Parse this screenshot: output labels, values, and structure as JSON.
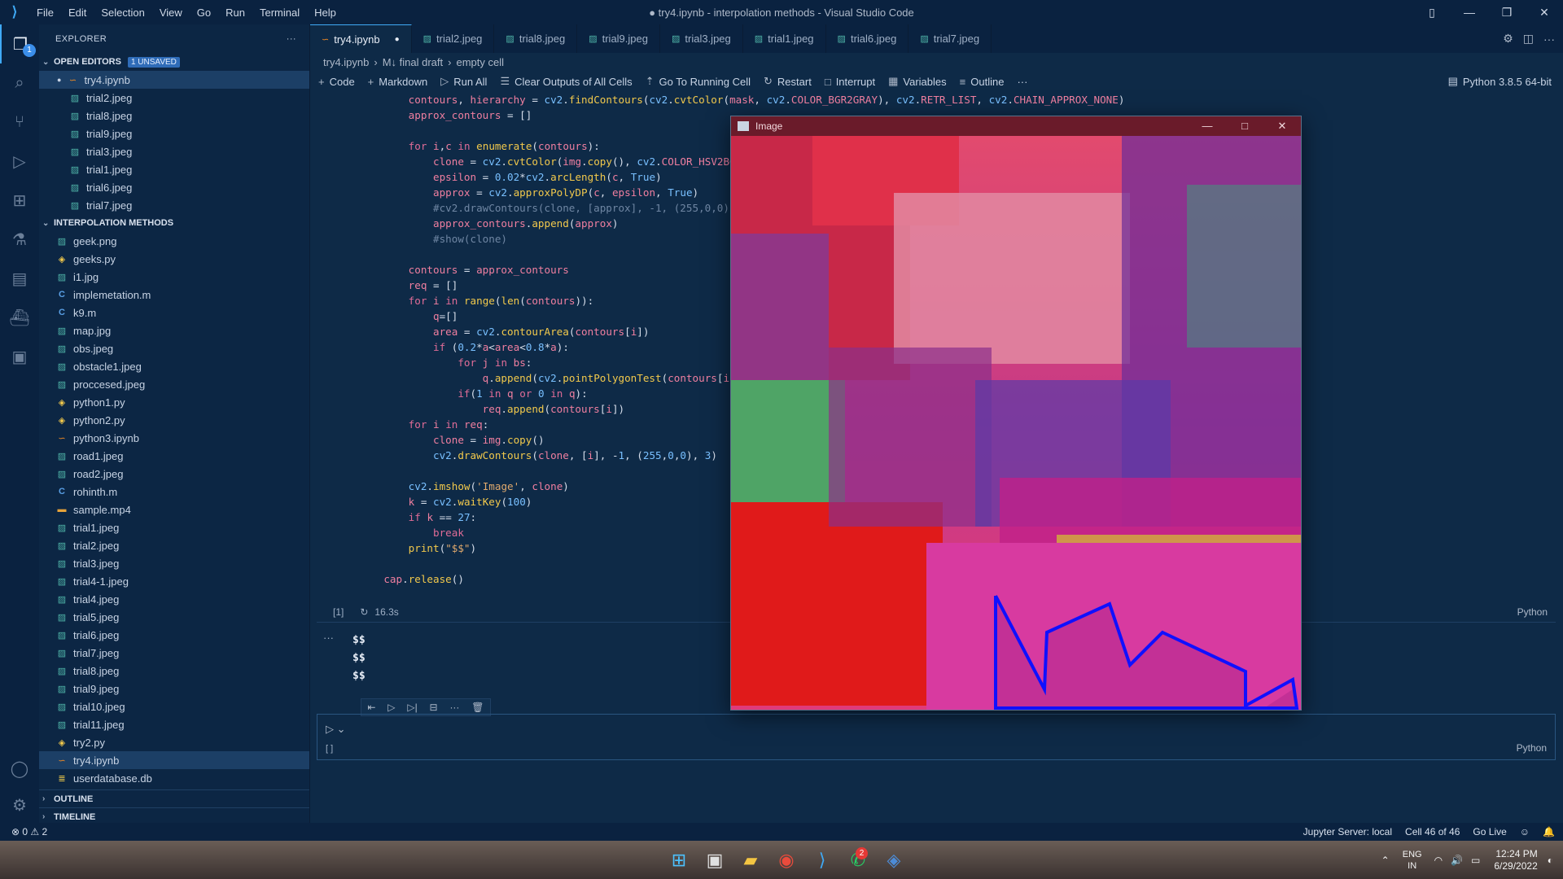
{
  "app": {
    "window_title": "● try4.ipynb - interpolation methods - Visual Studio Code",
    "menu": [
      "File",
      "Edit",
      "Selection",
      "View",
      "Go",
      "Run",
      "Terminal",
      "Help"
    ]
  },
  "explorer": {
    "title": "EXPLORER",
    "open_editors_label": "OPEN EDITORS",
    "unsaved_badge": "1 UNSAVED",
    "open_editors": [
      "try4.ipynb",
      "trial2.jpeg",
      "trial8.jpeg",
      "trial9.jpeg",
      "trial3.jpeg",
      "trial1.jpeg",
      "trial6.jpeg",
      "trial7.jpeg"
    ],
    "folder_label": "INTERPOLATION METHODS",
    "files": [
      {
        "name": "geek.png",
        "type": "img"
      },
      {
        "name": "geeks.py",
        "type": "py"
      },
      {
        "name": "i1.jpg",
        "type": "img"
      },
      {
        "name": "implemetation.m",
        "type": "m"
      },
      {
        "name": "k9.m",
        "type": "m"
      },
      {
        "name": "map.jpg",
        "type": "img"
      },
      {
        "name": "obs.jpeg",
        "type": "img"
      },
      {
        "name": "obstacle1.jpeg",
        "type": "img"
      },
      {
        "name": "proccesed.jpeg",
        "type": "img"
      },
      {
        "name": "python1.py",
        "type": "py"
      },
      {
        "name": "python2.py",
        "type": "py"
      },
      {
        "name": "python3.ipynb",
        "type": "nb"
      },
      {
        "name": "road1.jpeg",
        "type": "img"
      },
      {
        "name": "road2.jpeg",
        "type": "img"
      },
      {
        "name": "rohinth.m",
        "type": "m"
      },
      {
        "name": "sample.mp4",
        "type": "vid"
      },
      {
        "name": "trial1.jpeg",
        "type": "img"
      },
      {
        "name": "trial2.jpeg",
        "type": "img"
      },
      {
        "name": "trial3.jpeg",
        "type": "img"
      },
      {
        "name": "trial4-1.jpeg",
        "type": "img"
      },
      {
        "name": "trial4.jpeg",
        "type": "img"
      },
      {
        "name": "trial5.jpeg",
        "type": "img"
      },
      {
        "name": "trial6.jpeg",
        "type": "img"
      },
      {
        "name": "trial7.jpeg",
        "type": "img"
      },
      {
        "name": "trial8.jpeg",
        "type": "img"
      },
      {
        "name": "trial9.jpeg",
        "type": "img"
      },
      {
        "name": "trial10.jpeg",
        "type": "img"
      },
      {
        "name": "trial11.jpeg",
        "type": "img"
      },
      {
        "name": "try2.py",
        "type": "py"
      },
      {
        "name": "try4.ipynb",
        "type": "nb",
        "selected": true
      },
      {
        "name": "userdatabase.db",
        "type": "db"
      }
    ],
    "outline_label": "OUTLINE",
    "timeline_label": "TIMELINE"
  },
  "tabs": [
    "try4.ipynb",
    "trial2.jpeg",
    "trial8.jpeg",
    "trial9.jpeg",
    "trial3.jpeg",
    "trial1.jpeg",
    "trial6.jpeg",
    "trial7.jpeg"
  ],
  "breadcrumb": [
    "try4.ipynb",
    "M↓ final draft",
    "empty cell"
  ],
  "toolbar": {
    "code": "Code",
    "markdown": "Markdown",
    "run_all": "Run All",
    "clear_outputs": "Clear Outputs of All Cells",
    "go_running": "Go To Running Cell",
    "restart": "Restart",
    "interrupt": "Interrupt",
    "variables": "Variables",
    "outline": "Outline",
    "kernel": "Python 3.8.5 64-bit"
  },
  "cell": {
    "exec_count": "[1]",
    "duration": "16.3s",
    "language": "Python",
    "output_lines": [
      "$$",
      "$$",
      "$$"
    ],
    "empty_exec": "[ ]"
  },
  "image_window": {
    "title": "Image",
    "overlay_color": "#1010ff"
  },
  "status": {
    "problems": "⊗ 0 ⚠ 2",
    "jupyter": "Jupyter Server: local",
    "cell_pos": "Cell 46 of 46",
    "golive": "Go Live"
  },
  "taskbar": {
    "lang_top": "ENG",
    "lang_bottom": "IN",
    "time": "12:24 PM",
    "date": "6/29/2022",
    "whatsapp_badge": "2"
  },
  "colors": {
    "accent": "#3fa9f5",
    "editor_bg": "#0e2a47",
    "sidebar_bg": "#0c2644"
  }
}
